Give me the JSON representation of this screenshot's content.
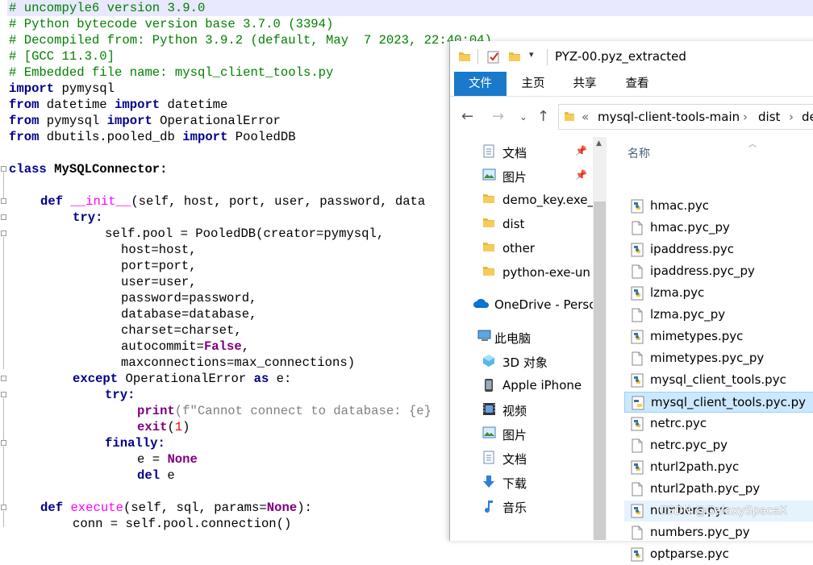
{
  "editor": {
    "comments": [
      "# uncompyle6 version 3.9.0",
      "# Python bytecode version base 3.7.0 (3394)",
      "# Decompiled from: Python 3.9.2 (default, May  7 2023, 22:40:04)",
      "# [GCC 11.3.0]",
      "# Embedded file name: mysql_client_tools.py"
    ],
    "imports": [
      {
        "kw": "import",
        "mod": " pymysql",
        "kw2": "",
        "name": ""
      },
      {
        "kw": "from",
        "mod": " datetime ",
        "kw2": "import",
        "name": " datetime"
      },
      {
        "kw": "from",
        "mod": " pymysql ",
        "kw2": "import",
        "name": " OperationalError"
      },
      {
        "kw": "from",
        "mod": " dbutils.pooled_db ",
        "kw2": "import",
        "name": " PooledDB"
      }
    ],
    "class_kw": "class",
    "class_name": " MySQLConnector:",
    "def_kw": "def",
    "init_name": "__init__",
    "init_args": "(self, host, port, user, password, data",
    "try_kw": "try:",
    "pool_line": "self.pool = PooledDB(creator=pymysql,",
    "kwargs": [
      "host=host,",
      "port=port,",
      "user=user,",
      "password=password,",
      "database=database,",
      "charset=charset,"
    ],
    "autocommit_pre": "autocommit=",
    "autocommit_val": "False",
    "autocommit_post": ",",
    "maxconn": "maxconnections=max_connections)",
    "except_kw": "except",
    "except_name": " OperationalError ",
    "as_kw": "as",
    "except_var": " e:",
    "try2": "try:",
    "print_fn": "print",
    "print_args": "(f\"Cannot connect to database: {e}",
    "exit_fn": "exit",
    "exit_args_open": "(",
    "exit_num": "1",
    "exit_args_close": ")",
    "finally_kw": "finally:",
    "e_assign": "e = ",
    "none_val": "None",
    "del_kw": "del",
    "del_var": " e",
    "execute_name": "execute",
    "execute_args": "(self, sql, params=",
    "execute_none": "None",
    "execute_close": "):",
    "conn_line": "conn = self.pool.connection()"
  },
  "explorer": {
    "title": "PYZ-00.pyz_extracted",
    "ribbon_tabs": [
      "文件",
      "主页",
      "共享",
      "查看"
    ],
    "breadcrumb": [
      "«",
      "mysql-client-tools-main",
      "›",
      "dist",
      "›",
      "de"
    ],
    "nav_items": [
      {
        "label": "文档",
        "pinned": true
      },
      {
        "label": "图片",
        "pinned": true
      },
      {
        "label": "demo_key.exe_",
        "pinned": false
      },
      {
        "label": "dist",
        "pinned": false
      },
      {
        "label": "other",
        "pinned": false
      },
      {
        "label": "python-exe-un",
        "pinned": false
      },
      {
        "label": "OneDrive - Perso",
        "pinned": false
      },
      {
        "label": "此电脑",
        "pinned": false
      },
      {
        "label": "3D 对象",
        "pinned": false
      },
      {
        "label": "Apple iPhone",
        "pinned": false
      },
      {
        "label": "视频",
        "pinned": false
      },
      {
        "label": "图片",
        "pinned": false
      },
      {
        "label": "文档",
        "pinned": false
      },
      {
        "label": "下载",
        "pinned": false
      },
      {
        "label": "音乐",
        "pinned": false
      }
    ],
    "column_header": "名称",
    "files": [
      {
        "name": "hmac.pyc",
        "type": "pyc"
      },
      {
        "name": "hmac.pyc_py",
        "type": "txt"
      },
      {
        "name": "ipaddress.pyc",
        "type": "pyc"
      },
      {
        "name": "ipaddress.pyc_py",
        "type": "txt"
      },
      {
        "name": "lzma.pyc",
        "type": "pyc"
      },
      {
        "name": "lzma.pyc_py",
        "type": "txt"
      },
      {
        "name": "mimetypes.pyc",
        "type": "pyc"
      },
      {
        "name": "mimetypes.pyc_py",
        "type": "txt"
      },
      {
        "name": "mysql_client_tools.pyc",
        "type": "pyc"
      },
      {
        "name": "mysql_client_tools.pyc.py",
        "type": "py",
        "selected": true
      },
      {
        "name": "netrc.pyc",
        "type": "pyc"
      },
      {
        "name": "netrc.pyc_py",
        "type": "txt"
      },
      {
        "name": "nturl2path.pyc",
        "type": "pyc"
      },
      {
        "name": "nturl2path.pyc_py",
        "type": "txt"
      },
      {
        "name": "numbers.pyc",
        "type": "pyc",
        "hover": true
      },
      {
        "name": "numbers.pyc_py",
        "type": "txt"
      },
      {
        "name": "optparse.pyc",
        "type": "pyc"
      }
    ]
  },
  "watermark": "CSDN @GalaxySpaceX"
}
